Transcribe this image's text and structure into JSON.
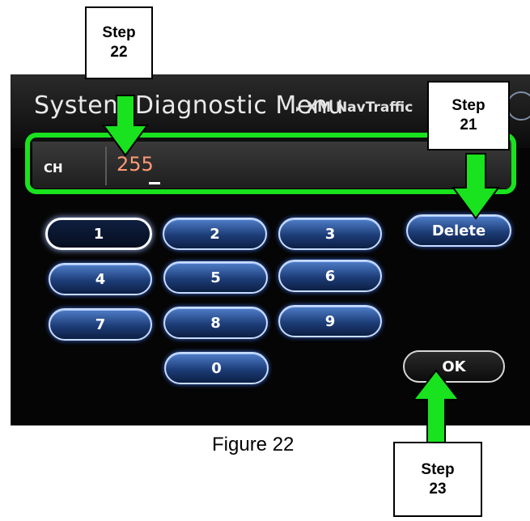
{
  "screen": {
    "title": "System Diagnostic Menu",
    "breadcrumb_arrow": "▸",
    "breadcrumb": "XM NavTraffic"
  },
  "input": {
    "label": "CH",
    "value": "255"
  },
  "keypad": {
    "keys": [
      "1",
      "2",
      "3",
      "4",
      "5",
      "6",
      "7",
      "8",
      "9",
      "0"
    ],
    "delete_label": "Delete",
    "ok_label": "OK"
  },
  "callouts": {
    "step22": [
      "Step",
      "22"
    ],
    "step21": [
      "Step",
      "21"
    ],
    "step23": [
      "Step",
      "23"
    ]
  },
  "caption": "Figure 22",
  "colors": {
    "callout_arrow": "#19e21e",
    "channel_value": "#ff9a76",
    "key_blue": "#1d3d78"
  }
}
